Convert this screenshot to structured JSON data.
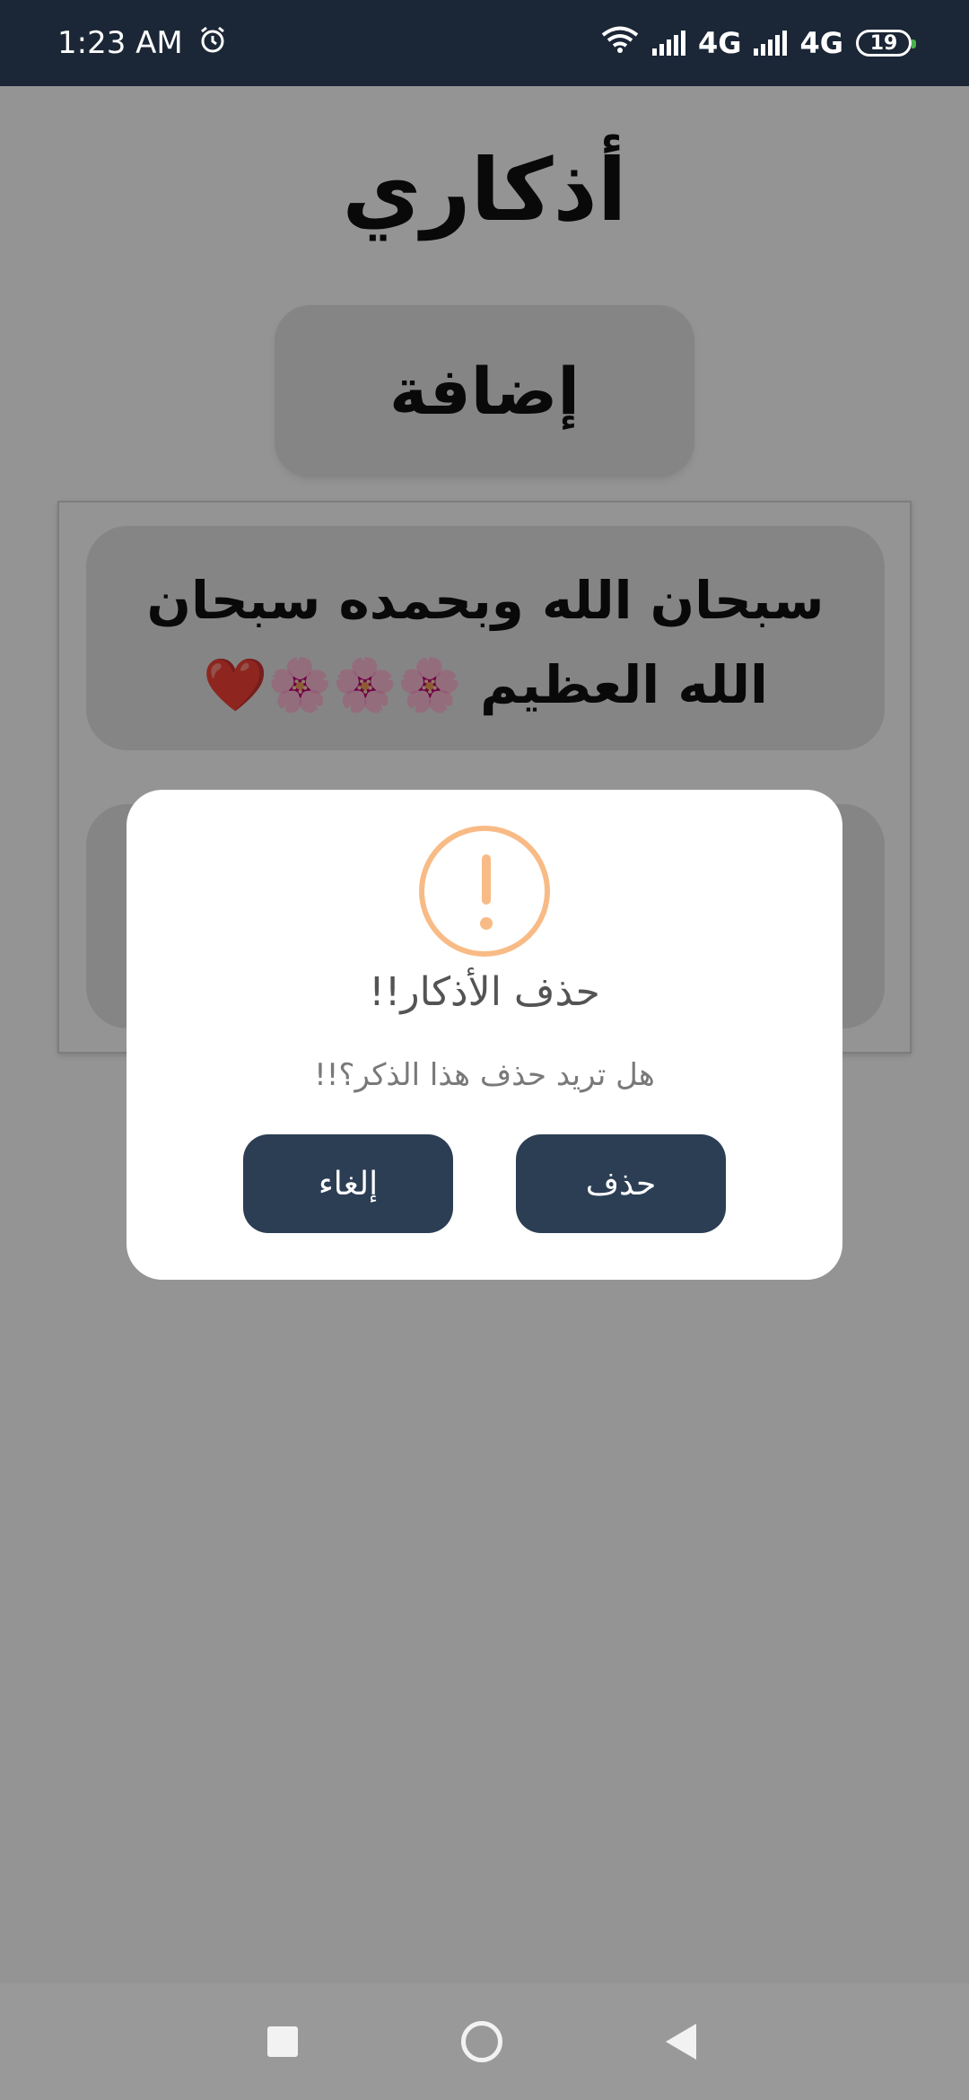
{
  "status_bar": {
    "time": "1:23 AM",
    "alarm_icon": "alarm-clock-icon",
    "network_1": "4G",
    "network_2": "4G",
    "battery": "19"
  },
  "app": {
    "title": "أذكاري",
    "add_button": "إضافة",
    "zikr_items": [
      {
        "text": "سبحان الله وبحمده سبحان الله العظيم 🌸🌸🌸❤️"
      },
      {
        "text": ""
      }
    ]
  },
  "dialog": {
    "icon": "warning-icon",
    "title": "حذف الأذكار!!",
    "text": "هل تريد حذف هذا الذكر؟!!",
    "cancel_label": "إلغاء",
    "delete_label": "حذف",
    "accent_color": "#f8bb86",
    "button_color": "#2c3e54"
  },
  "nav_bar": {
    "recents": "square-icon",
    "home": "circle-icon",
    "back": "triangle-back-icon"
  }
}
